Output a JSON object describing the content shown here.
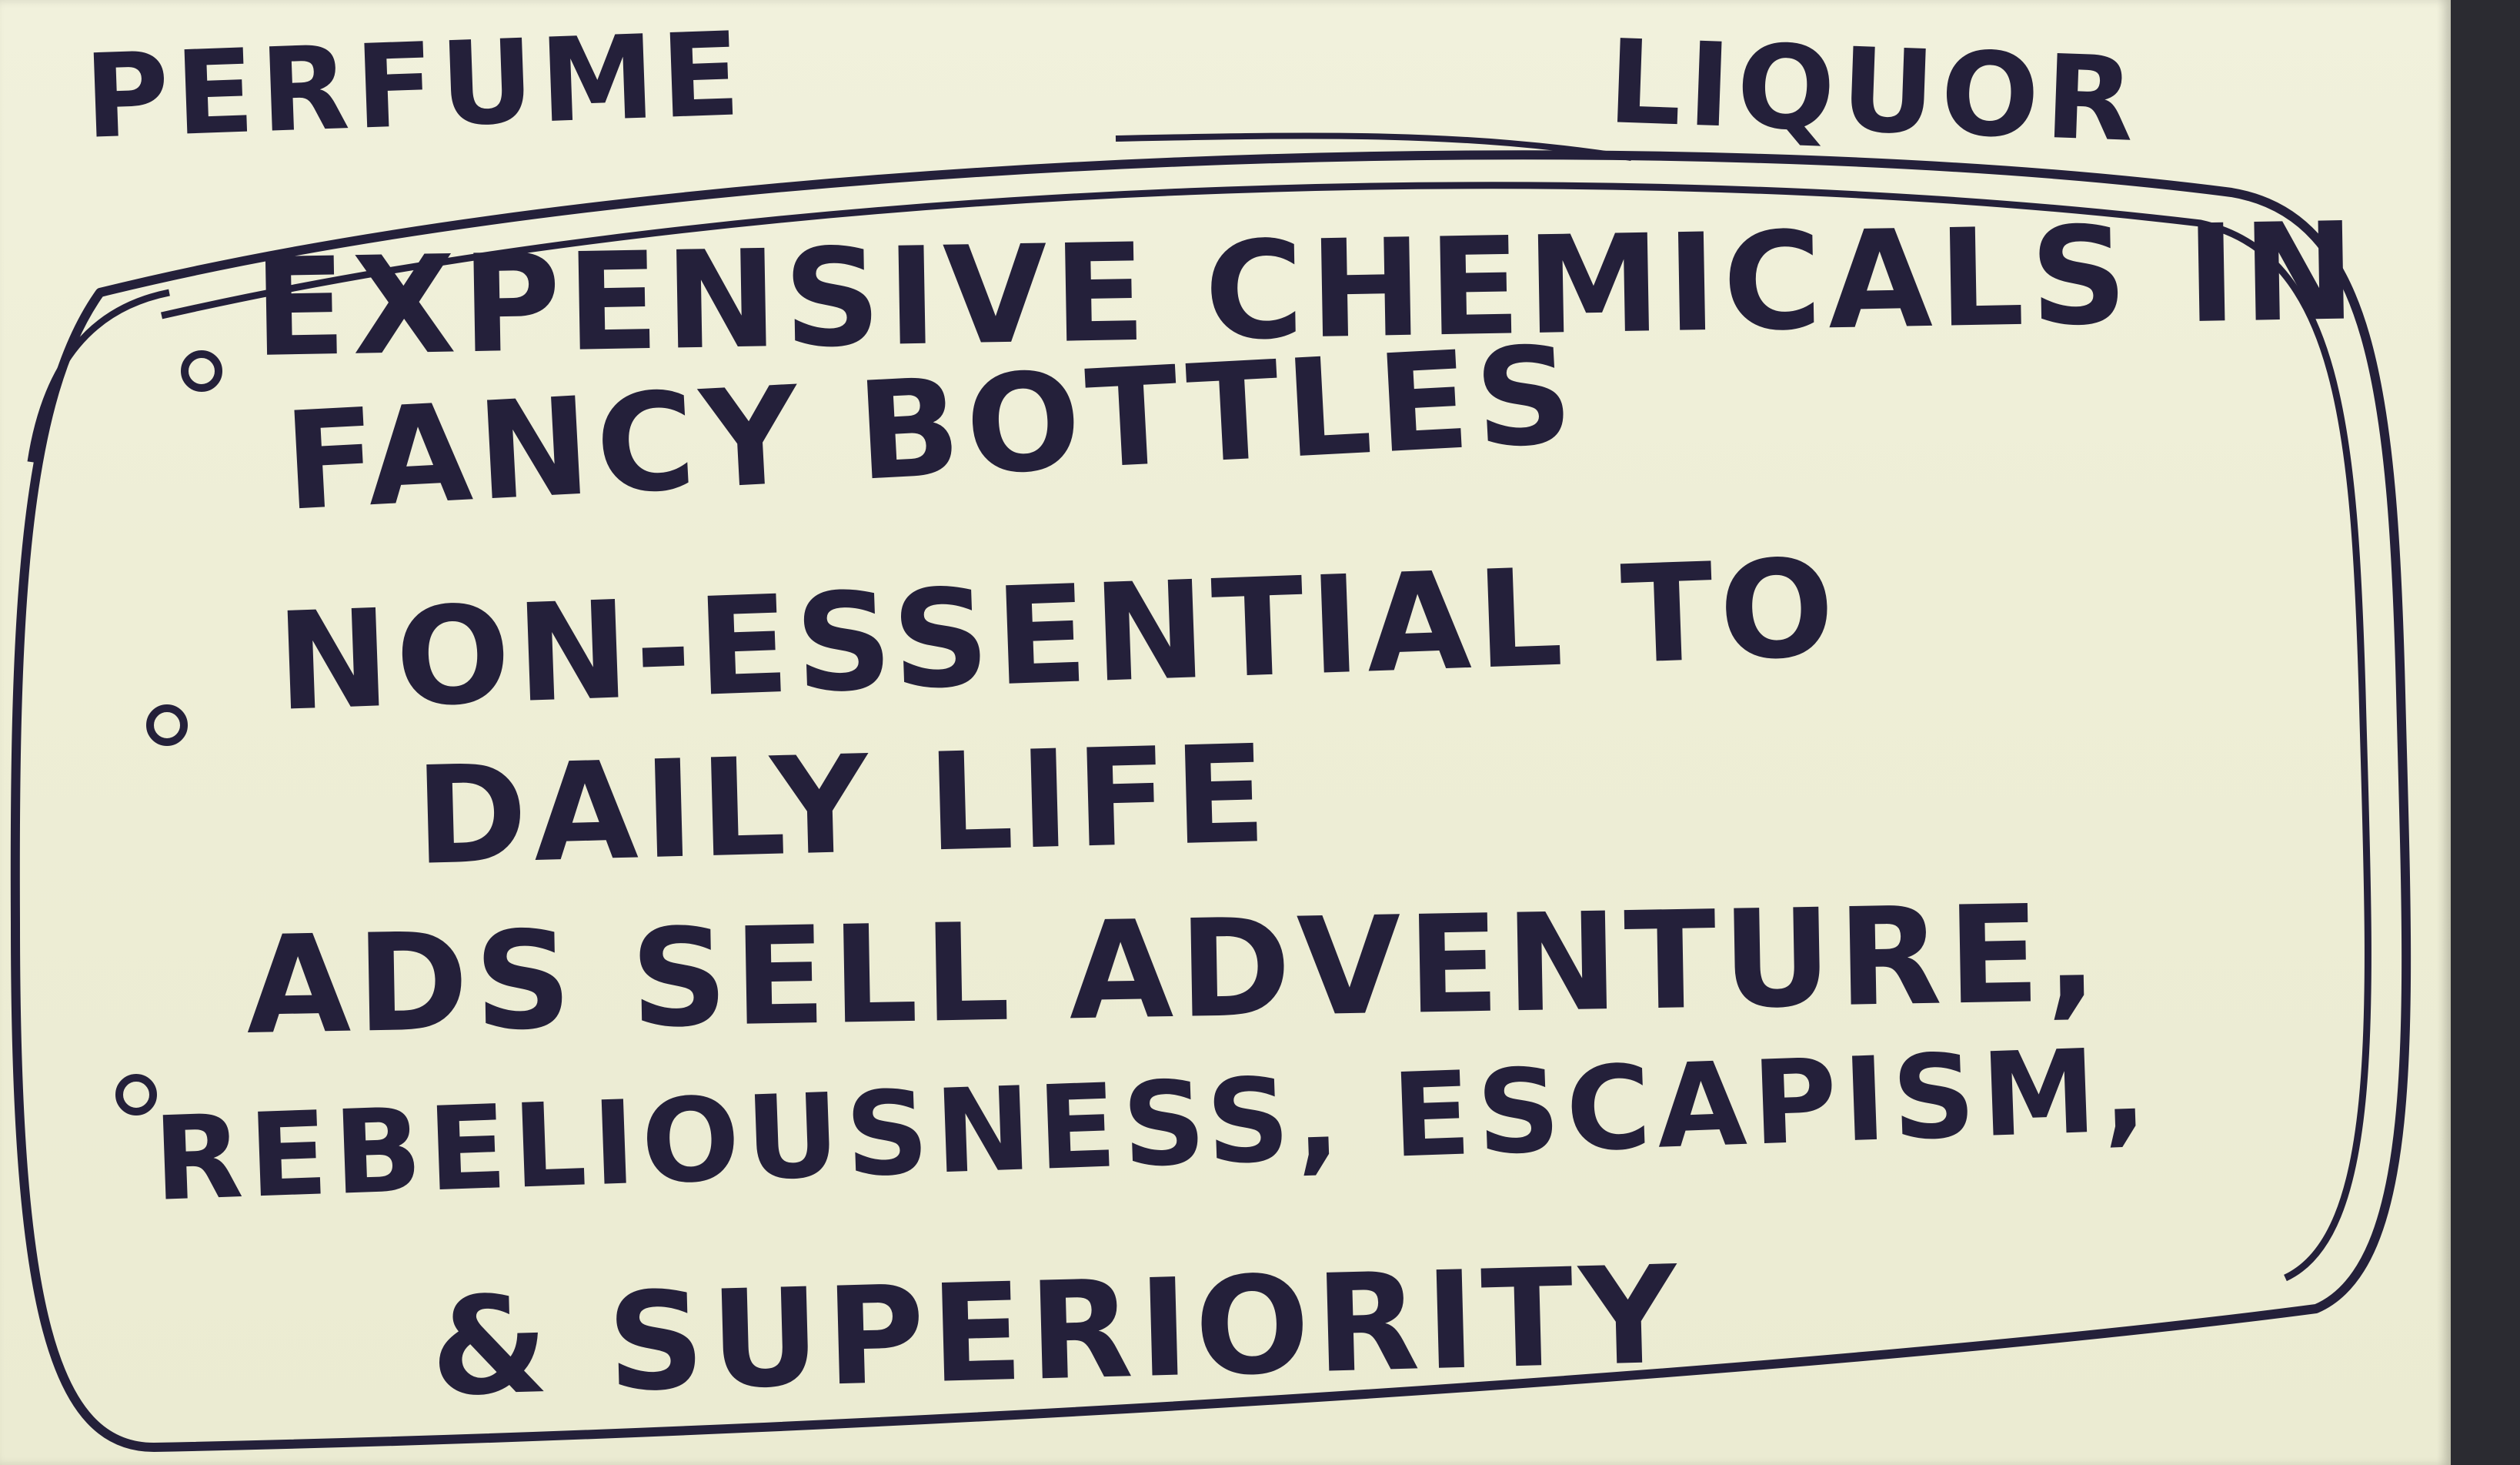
{
  "note": {
    "headings": {
      "left": "PERFUME",
      "right": "LIQUOR"
    },
    "items": [
      {
        "lines": [
          "EXPENSIVE CHEMICALS IN",
          "FANCY BOTTLES"
        ]
      },
      {
        "lines": [
          "NON-ESSENTIAL TO",
          "DAILY LIFE"
        ]
      },
      {
        "lines": [
          "ADS SELL ADVENTURE,",
          "REBELIOUSNESS, ESCAPISM,",
          "& SUPERIORITY"
        ]
      }
    ]
  },
  "colors": {
    "paper": "#efefd8",
    "ink": "#24203a",
    "background": "#2b2b31"
  }
}
